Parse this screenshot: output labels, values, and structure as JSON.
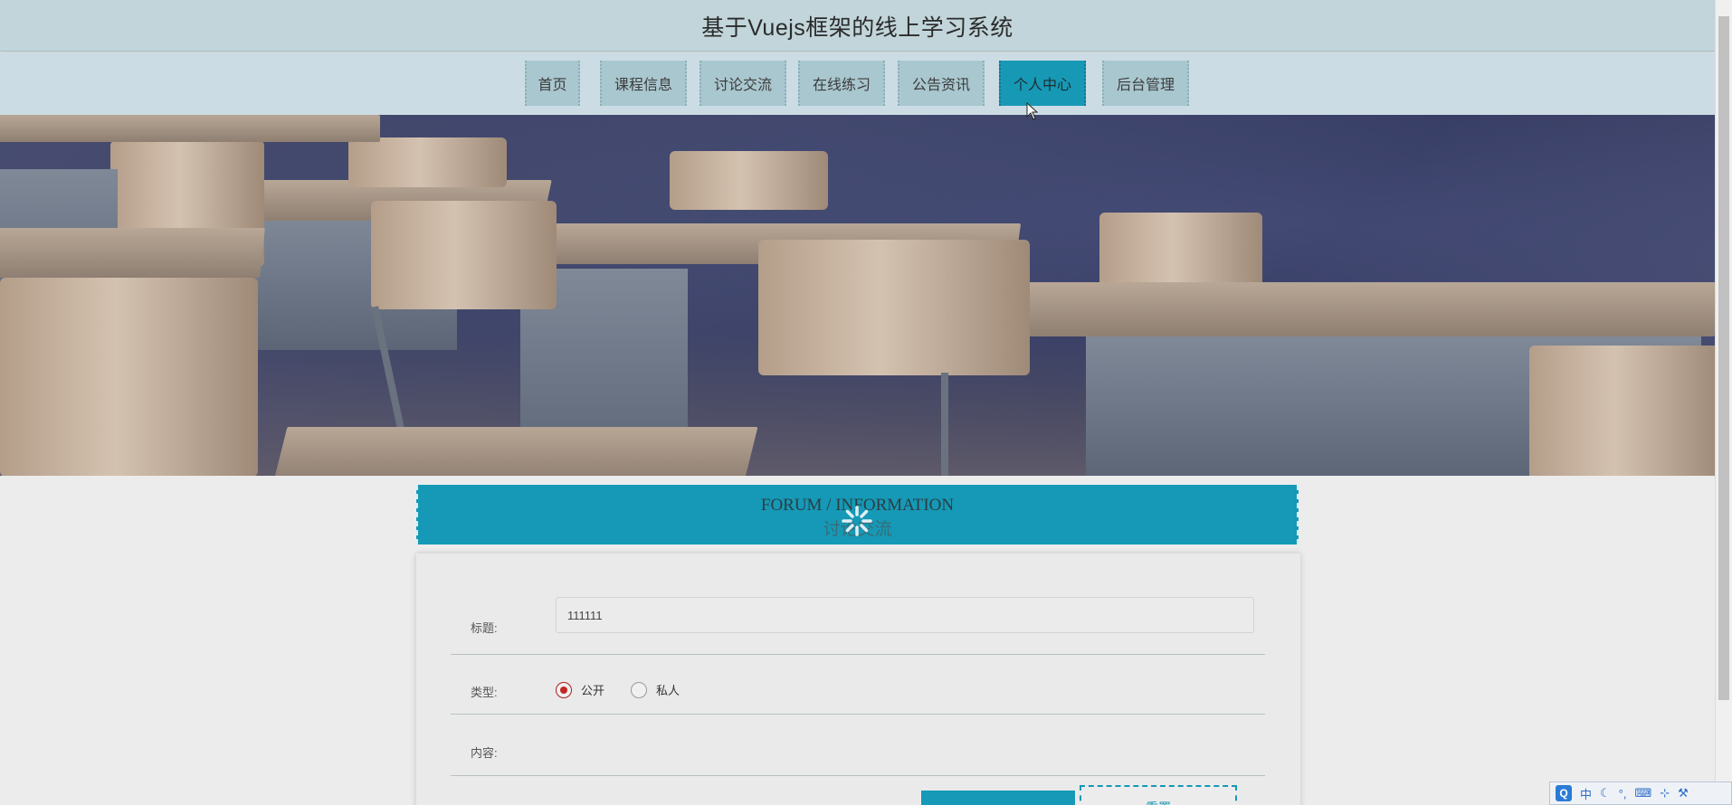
{
  "header": {
    "site_title": "基于Vuejs框架的线上学习系统"
  },
  "nav": {
    "items": [
      {
        "label": "首页",
        "active": false
      },
      {
        "label": "课程信息",
        "active": false
      },
      {
        "label": "讨论交流",
        "active": false
      },
      {
        "label": "在线练习",
        "active": false
      },
      {
        "label": "公告资讯",
        "active": false
      },
      {
        "label": "个人中心",
        "active": true
      },
      {
        "label": "后台管理",
        "active": false
      }
    ]
  },
  "section": {
    "title_en": "FORUM / INFORMATION",
    "title_cn": "讨论交流"
  },
  "form": {
    "title_label": "标题:",
    "title_value": "111111",
    "type_label": "类型:",
    "type_options": [
      "公开",
      "私人"
    ],
    "type_selected": "公开",
    "content_label": "内容:",
    "submit_label": "",
    "reset_label": "重置"
  },
  "ime": {
    "logo": "Q",
    "mode": "中",
    "icons": [
      "moon-icon",
      "punctuation-icon",
      "keyboard-icon",
      "fullwidth-icon",
      "wrench-icon"
    ]
  },
  "colors": {
    "accent": "#1599b6",
    "header_bg": "#c1d5da",
    "nav_bg": "#ccdce4",
    "radio_checked": "#c42626"
  }
}
